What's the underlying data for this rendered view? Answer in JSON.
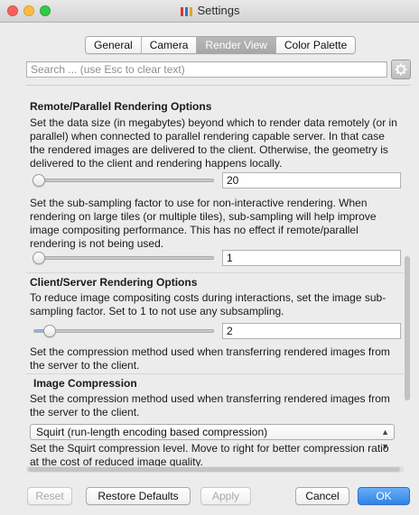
{
  "window": {
    "title": "Settings"
  },
  "tabs": [
    {
      "label": "General",
      "active": false
    },
    {
      "label": "Camera",
      "active": false
    },
    {
      "label": "Render View",
      "active": true
    },
    {
      "label": "Color Palette",
      "active": false
    }
  ],
  "search": {
    "placeholder": "Search ... (use Esc to clear text)",
    "value": ""
  },
  "settings": {
    "remote": {
      "heading": "Remote/Parallel Rendering Options",
      "data_size_desc": "Set the data size (in megabytes) beyond which to render data remotely (or in parallel) when connected to parallel rendering capable server. In that case the rendered images are delivered to the client. Otherwise, the geometry is delivered to the client and rendering happens locally.",
      "data_size_value": "20",
      "subsampling_desc": "Set the sub-sampling factor to use for non-interactive rendering. When rendering on large tiles (or multiple tiles), sub-sampling will help improve image compositing performance. This has no effect if remote/parallel rendering is not being used.",
      "subsampling_value": "1"
    },
    "client_server": {
      "heading": "Client/Server Rendering Options",
      "subsample_desc": "To reduce image compositing costs during interactions, set the image sub-sampling factor. Set to 1 to not use any subsampling.",
      "subsample_value": "2",
      "compression_desc": "Set the compression method used when transferring rendered images from the server to the client."
    },
    "image_compression": {
      "heading": "Image Compression",
      "desc": "Set the compression method used when transferring rendered images from the server to the client.",
      "selected": "Squirt (run-length encoding based compression)",
      "level_desc": "Set the Squirt compression level. Move to right for better compression ratio at the cost of reduced image quality."
    }
  },
  "buttons": {
    "reset": "Reset",
    "restore_defaults": "Restore Defaults",
    "apply": "Apply",
    "cancel": "Cancel",
    "ok": "OK"
  },
  "colors": {
    "accent": "#2f83e6",
    "tab_active": "#a6a6a6"
  }
}
